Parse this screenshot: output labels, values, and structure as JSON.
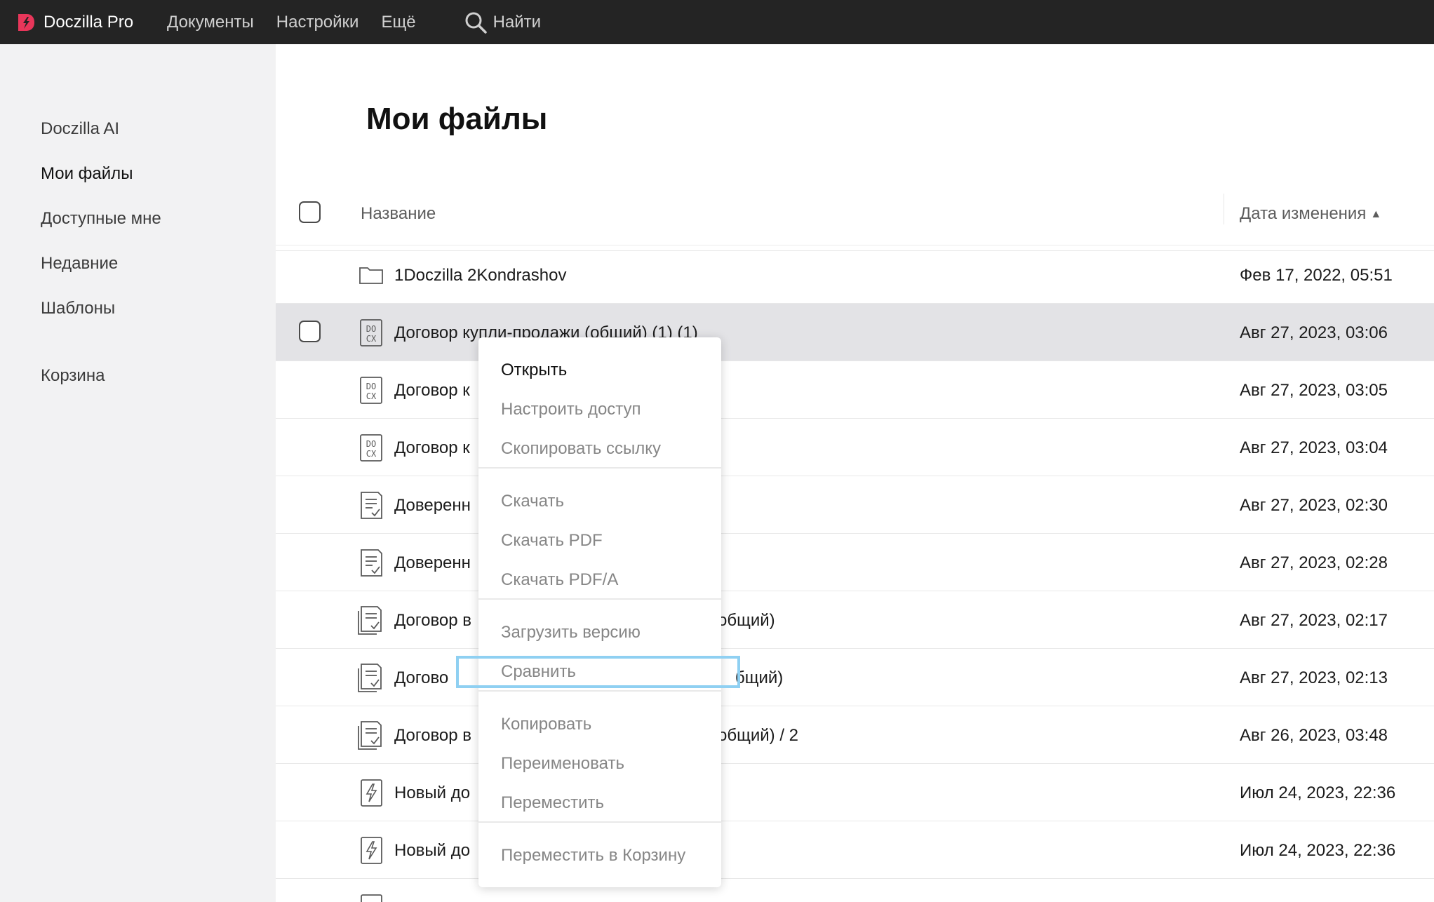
{
  "app": {
    "name": "Doczilla Pro",
    "brand_color": "#e8365a"
  },
  "topbar": {
    "nav": [
      "Документы",
      "Настройки",
      "Ещё"
    ],
    "search_label": "Найти"
  },
  "sidebar": {
    "items": [
      "Doczilla AI",
      "Мои файлы",
      "Доступные мне",
      "Недавние",
      "Шаблоны",
      "Корзина"
    ],
    "active": "Мои файлы"
  },
  "main": {
    "title": "Мои файлы",
    "columns": {
      "name": "Название",
      "date": "Дата изменения",
      "sort_indicator": "🠝"
    },
    "rows": [
      {
        "name": "1Doczilla 2Kondrashov",
        "tail": "",
        "date": "Фев 17, 2022, 05:51",
        "icon": "folder-icon"
      },
      {
        "name": "Договор купли-продажи (общий) (1) (1)",
        "tail": "",
        "date": "Авг 27, 2023, 03:06",
        "icon": "docx-icon"
      },
      {
        "name": "Договор к",
        "tail": "",
        "date": "Авг 27, 2023, 03:05",
        "icon": "docx-icon"
      },
      {
        "name": "Договор к",
        "tail": "",
        "date": "Авг 27, 2023, 03:04",
        "icon": "docx-icon"
      },
      {
        "name": "Доверенн",
        "tail": "",
        "date": "Авг 27, 2023, 02:30",
        "icon": "template-doc-icon"
      },
      {
        "name": "Доверенн",
        "tail": "",
        "date": "Авг 27, 2023, 02:28",
        "icon": "template-doc-icon"
      },
      {
        "name": "Договор в",
        "tail": "общий)",
        "date": "Авг 27, 2023, 02:17",
        "icon": "template-stack-icon"
      },
      {
        "name": "Догово",
        "tail": "бщий)",
        "date": "Авг 27, 2023, 02:13",
        "icon": "template-stack-icon"
      },
      {
        "name": "Договор в",
        "tail": "общий) / 2",
        "date": "Авг 26, 2023, 03:48",
        "icon": "template-stack-icon"
      },
      {
        "name": "Новый до",
        "tail": "",
        "date": "Июл 24, 2023, 22:36",
        "icon": "doczilla-doc-icon"
      },
      {
        "name": "Новый до",
        "tail": "",
        "date": "Июл 24, 2023, 22:36",
        "icon": "doczilla-doc-icon"
      }
    ]
  },
  "context_menu": {
    "open": "Открыть",
    "share": "Настроить доступ",
    "copy_link": "Скопировать ссылку",
    "download": "Скачать",
    "download_pdf": "Скачать PDF",
    "download_pdfa": "Скачать PDF/A",
    "upload_version": "Загрузить версию",
    "compare": "Сравнить",
    "copy": "Копировать",
    "rename": "Переименовать",
    "move": "Переместить",
    "trash": "Переместить в Корзину"
  }
}
